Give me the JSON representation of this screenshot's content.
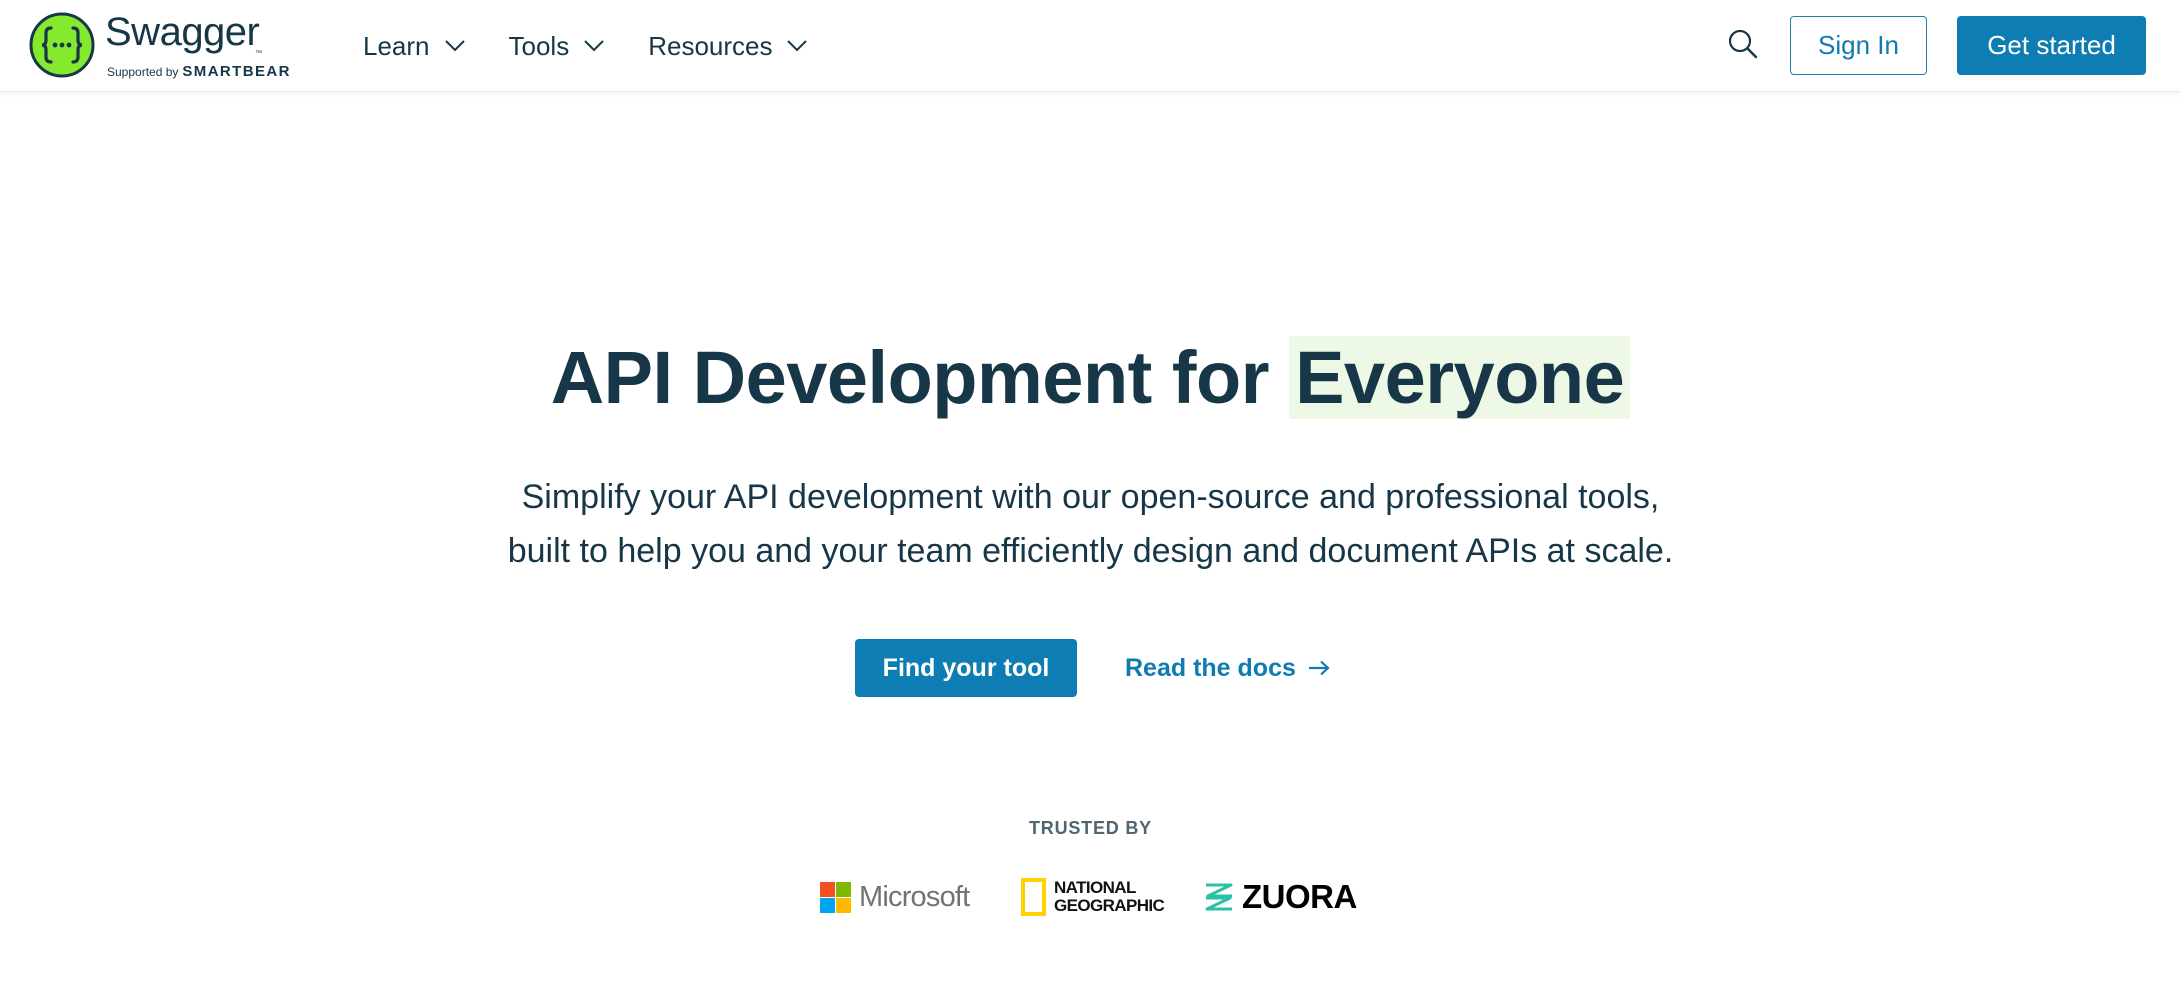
{
  "colors": {
    "brand_green": "#85ea2d",
    "navy": "#173647",
    "accent_blue": "#0e7db3",
    "highlight_bg": "#edf9e6"
  },
  "header": {
    "logo": {
      "wordmark": "Swagger",
      "tm": "™",
      "supported_by": "Supported by",
      "sponsor": "SMARTBEAR",
      "icon": "swagger-braces-icon"
    },
    "nav": [
      {
        "label": "Learn",
        "icon": "chevron-down-icon"
      },
      {
        "label": "Tools",
        "icon": "chevron-down-icon"
      },
      {
        "label": "Resources",
        "icon": "chevron-down-icon"
      }
    ],
    "search_icon": "search-icon",
    "sign_in_label": "Sign In",
    "get_started_label": "Get started"
  },
  "hero": {
    "title_prefix": "API Development for",
    "title_highlight": "Everyone",
    "subtitle_line1": "Simplify your API development with our open-source and professional tools,",
    "subtitle_line2": "built to help you and your team efficiently design and document APIs at scale.",
    "primary_cta": "Find your tool",
    "secondary_cta": "Read the docs",
    "secondary_cta_icon": "arrow-right-icon"
  },
  "trusted": {
    "label": "TRUSTED BY",
    "brands": [
      {
        "name": "Microsoft",
        "colors": [
          "#f25022",
          "#7fba00",
          "#00a4ef",
          "#ffb900"
        ]
      },
      {
        "name_line1": "NATIONAL",
        "name_line2": "GEOGRAPHIC",
        "color": "#ffd200"
      },
      {
        "name": "ZUORA",
        "color": "#2bc0a8"
      }
    ]
  }
}
